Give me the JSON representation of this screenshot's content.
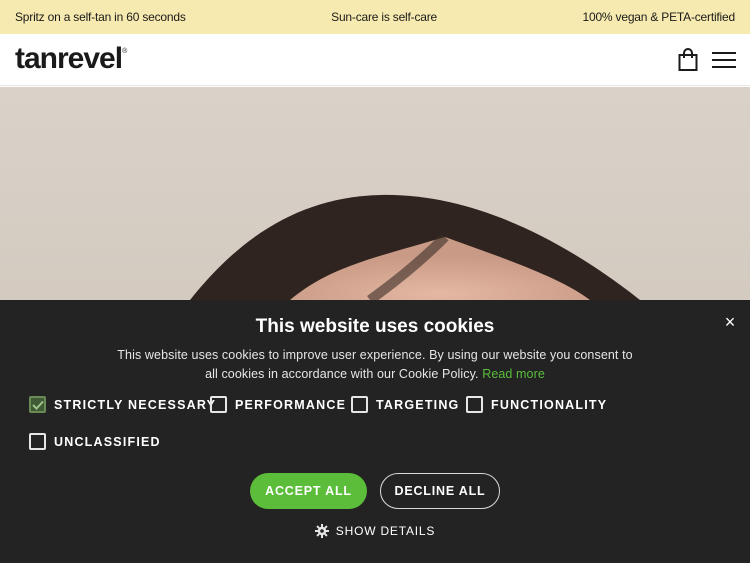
{
  "announcement": {
    "left": "Spritz on a self-tan in 60 seconds",
    "center": "Sun-care is self-care",
    "right": "100% vegan & PETA-certified"
  },
  "header": {
    "logo": "tanrevel",
    "logo_mark": "®",
    "icons": [
      "shopping-bag-icon",
      "hamburger-menu-icon"
    ]
  },
  "cookie_banner": {
    "title": "This website uses cookies",
    "description": "This website uses cookies to improve user experience. By using our website you consent to all cookies in accordance with our Cookie Policy.",
    "read_more": "Read more",
    "categories": [
      {
        "label": "STRICTLY NECESSARY",
        "checked": true
      },
      {
        "label": "PERFORMANCE",
        "checked": false
      },
      {
        "label": "TARGETING",
        "checked": false
      },
      {
        "label": "FUNCTIONALITY",
        "checked": false
      },
      {
        "label": "UNCLASSIFIED",
        "checked": false
      }
    ],
    "accept_label": "ACCEPT ALL",
    "decline_label": "DECLINE ALL",
    "details_label": "SHOW DETAILS",
    "close_glyph": "×",
    "accent_color": "#5bbd3a",
    "background_color": "#232323"
  },
  "colors": {
    "announcement_bg": "#f7eab0",
    "hero_bg": "#d6cdc3",
    "hair": "#2f241f"
  }
}
